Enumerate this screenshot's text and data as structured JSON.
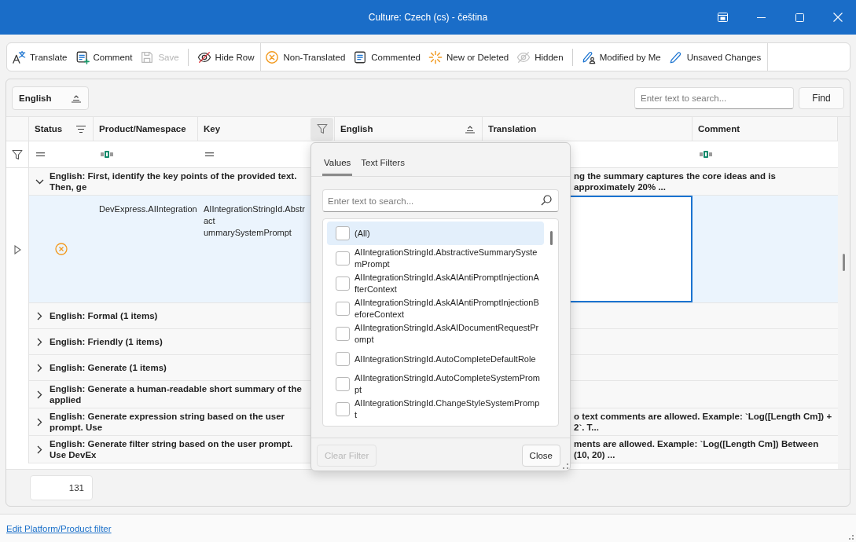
{
  "window": {
    "title": "Culture: Czech (cs) - čeština"
  },
  "toolbar": {
    "sections": [
      {
        "groups": [
          {
            "items": [
              {
                "label": "Translate",
                "disabled": false
              },
              {
                "label": "Comment",
                "disabled": false
              },
              {
                "label": "Save",
                "disabled": true
              }
            ]
          },
          {
            "items": [
              {
                "label": "Hide Row",
                "disabled": false
              }
            ]
          }
        ]
      },
      {
        "groups": [
          {
            "items": [
              {
                "label": "Non-Translated",
                "disabled": false
              },
              {
                "label": "Commented",
                "disabled": false
              },
              {
                "label": "New or Deleted",
                "disabled": false
              },
              {
                "label": "Hidden",
                "disabled": false
              }
            ]
          },
          {
            "items": [
              {
                "label": "Modified by Me",
                "disabled": false
              },
              {
                "label": "Unsaved Changes",
                "disabled": false
              }
            ]
          }
        ]
      }
    ]
  },
  "group_panel": {
    "label": "English"
  },
  "search": {
    "placeholder": "Enter text to search...",
    "button": "Find"
  },
  "grid": {
    "columns": [
      {
        "label": "Status",
        "filter_open": false
      },
      {
        "label": "Product/Namespace",
        "filter_open": false
      },
      {
        "label": "Key",
        "filter_open": true
      },
      {
        "label": "English",
        "filter_open": false
      },
      {
        "label": "Translation",
        "filter_open": false
      },
      {
        "label": "Comment",
        "filter_open": false
      }
    ],
    "groups": [
      {
        "text": "English: First, identify the key points of the provided text. Then, ge",
        "text_right": "ng the summary captures the core ideas and is approximately 20% ...",
        "expanded": true,
        "rows": [
          {
            "non_translated": true,
            "product": "DevExpress.AIIntegration",
            "key_lines": [
              "AIIntegrationStringId.Abstract",
              "ummarySystemPrompt"
            ],
            "selected": true,
            "editing": true
          }
        ]
      },
      {
        "text": "English: Formal (1 items)",
        "expanded": false
      },
      {
        "text": "English: Friendly (1 items)",
        "expanded": false
      },
      {
        "text": "English: Generate (1 items)",
        "expanded": false
      },
      {
        "text": "English: Generate a human-readable short summary of the applied",
        "expanded": false
      },
      {
        "text": "English: Generate expression string based on the user prompt. Use",
        "text_right": "o text comments are allowed. Example: `Log([Length Cm]) + 2`. T...",
        "expanded": false
      },
      {
        "text": "English: Generate filter string based on the user prompt. Use DevEx",
        "text_right": "ments are allowed. Example: `Log([Length Cm]) Between (10, 20) ...",
        "expanded": false
      }
    ],
    "summary": "131"
  },
  "filter_link": "Edit Platform/Product filter",
  "filter_popup": {
    "tabs": [
      {
        "label": "Values",
        "selected": true
      },
      {
        "label": "Text Filters",
        "selected": false
      }
    ],
    "search_placeholder": "Enter text to search...",
    "items": [
      {
        "label": "(All)",
        "checked": false,
        "selected": true
      },
      {
        "label": "AIIntegrationStringId.AbstractiveSummarySystemPrompt",
        "checked": false,
        "selected": false
      },
      {
        "label": "AIIntegrationStringId.AskAIAntiPromptInjectionAfterContext",
        "checked": false,
        "selected": false
      },
      {
        "label": "AIIntegrationStringId.AskAIAntiPromptInjectionBeforeContext",
        "checked": false,
        "selected": false
      },
      {
        "label": "AIIntegrationStringId.AskAIDocumentRequestPrompt",
        "checked": false,
        "selected": false
      },
      {
        "label": "AIIntegrationStringId.AutoCompleteDefaultRole",
        "checked": false,
        "selected": false
      },
      {
        "label": "AIIntegrationStringId.AutoCompleteSystemPrompt",
        "checked": false,
        "selected": false
      },
      {
        "label": "AIIntegrationStringId.ChangeStyleSystemPrompt",
        "checked": false,
        "selected": false
      }
    ],
    "buttons": [
      {
        "label": "Clear Filter",
        "disabled": true
      },
      {
        "label": "Close",
        "disabled": false
      }
    ]
  }
}
